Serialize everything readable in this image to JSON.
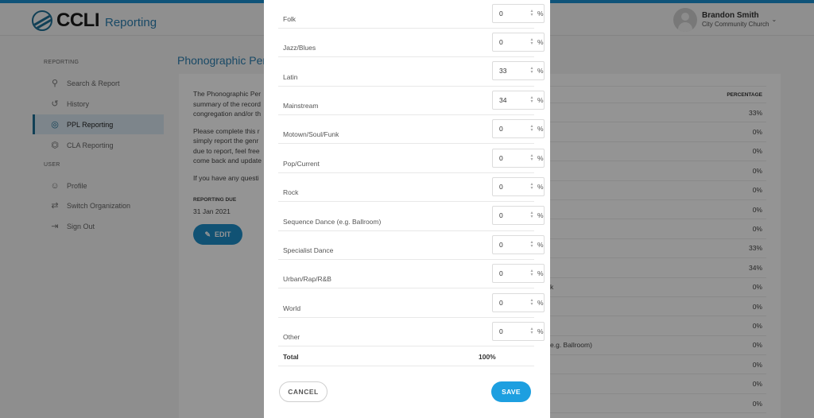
{
  "app": {
    "brand": "CCLI",
    "product": "Reporting",
    "accent_color": "#1d9fe0",
    "brand_color": "#1e6f95"
  },
  "user": {
    "name": "Brandon Smith",
    "organization": "City Community Church"
  },
  "sidebar": {
    "sections": [
      {
        "title": "REPORTING",
        "items": [
          {
            "label": "Search & Report",
            "icon": "search-icon",
            "active": false
          },
          {
            "label": "History",
            "icon": "history-icon",
            "active": false
          },
          {
            "label": "PPL Reporting",
            "icon": "ppl-icon",
            "active": true
          },
          {
            "label": "CLA Reporting",
            "icon": "scanner-icon",
            "active": false
          }
        ]
      },
      {
        "title": "USER",
        "items": [
          {
            "label": "Profile",
            "icon": "profile-icon",
            "active": false
          },
          {
            "label": "Switch Organization",
            "icon": "switch-icon",
            "active": false
          },
          {
            "label": "Sign Out",
            "icon": "sign-out-icon",
            "active": false
          }
        ]
      }
    ]
  },
  "page": {
    "title": "Phonographic Per",
    "intro_lines": [
      [
        "The Phonographic Per",
        "summary of the record",
        "congregation and/or th"
      ],
      [
        "Please complete this r",
        "simply report the genr",
        "due to report, feel free",
        "come back and update"
      ],
      [
        "If you have any questi"
      ]
    ],
    "reporting_due_label": "REPORTING DUE",
    "reporting_due_value": "31 Jan 2021",
    "edit_label": "EDIT",
    "table": {
      "header": "PERCENTAGE",
      "rows": [
        {
          "genre": "",
          "value": "33%"
        },
        {
          "genre": "",
          "value": "0%"
        },
        {
          "genre": "",
          "value": "0%"
        },
        {
          "genre": "",
          "value": "0%"
        },
        {
          "genre": "",
          "value": "0%"
        },
        {
          "genre": "",
          "value": "0%"
        },
        {
          "genre": "",
          "value": "0%"
        },
        {
          "genre": "",
          "value": "33%"
        },
        {
          "genre": "",
          "value": "34%"
        },
        {
          "genre": "k",
          "value": "0%"
        },
        {
          "genre": "",
          "value": "0%"
        },
        {
          "genre": "",
          "value": "0%"
        },
        {
          "genre": "e.g. Ballroom)",
          "value": "0%"
        },
        {
          "genre": "",
          "value": "0%"
        },
        {
          "genre": "",
          "value": "0%"
        },
        {
          "genre": "",
          "value": "0%"
        }
      ]
    }
  },
  "modal": {
    "genres": [
      {
        "label": "Folk",
        "value": "0"
      },
      {
        "label": "Jazz/Blues",
        "value": "0"
      },
      {
        "label": "Latin",
        "value": "33"
      },
      {
        "label": "Mainstream",
        "value": "34"
      },
      {
        "label": "Motown/Soul/Funk",
        "value": "0"
      },
      {
        "label": "Pop/Current",
        "value": "0"
      },
      {
        "label": "Rock",
        "value": "0"
      },
      {
        "label": "Sequence Dance (e.g. Ballroom)",
        "value": "0"
      },
      {
        "label": "Specialist Dance",
        "value": "0"
      },
      {
        "label": "Urban/Rap/R&B",
        "value": "0"
      },
      {
        "label": "World",
        "value": "0"
      },
      {
        "label": "Other",
        "value": "0"
      }
    ],
    "unit": "%",
    "total_label": "Total",
    "total_value": "100%",
    "cancel_label": "CANCEL",
    "save_label": "SAVE"
  }
}
